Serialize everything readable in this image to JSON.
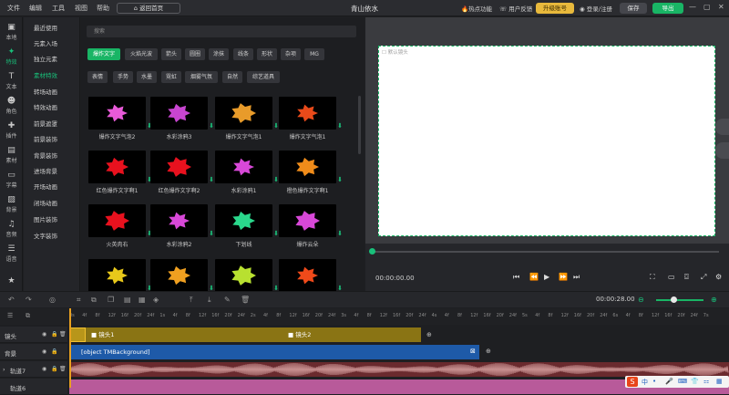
{
  "menu": [
    "文件",
    "编辑",
    "工具",
    "视图",
    "帮助"
  ],
  "home_button": "返回首页",
  "app_title": "青山依水",
  "header_right": {
    "hot": "热点功能",
    "feedback": "用户反馈",
    "upgrade": "升级账号",
    "login": "登录/注册",
    "save": "保存",
    "export": "导出"
  },
  "rail": [
    "本地",
    "特效",
    "文本",
    "角色",
    "插件",
    "素材",
    "字幕",
    "背景",
    "音频",
    "语音"
  ],
  "categories": [
    "最近使用",
    "元素入场",
    "独立元素",
    "素材特效",
    "转场动画",
    "特效动画",
    "前景遮罩",
    "前景装饰",
    "背景装饰",
    "进场背景",
    "开场动画",
    "闭场动画",
    "图片装饰",
    "文字装饰"
  ],
  "search_placeholder": "搜索",
  "chips_row1": [
    "爆炸文字",
    "火焰光波",
    "箭头",
    "圆圈",
    "涂抹",
    "线条",
    "形状",
    "杂项",
    "MG"
  ],
  "chips_row2": [
    "表情",
    "手势",
    "水墨",
    "霓虹",
    "烟雾气氛",
    "自然",
    "综艺道具"
  ],
  "effects": [
    {
      "label": "爆炸文字气泡2",
      "color": "#e85ad8"
    },
    {
      "label": "水彩涂鸦3",
      "color": "#c845d0"
    },
    {
      "label": "爆炸文字气泡1",
      "color": "#e89b2a"
    },
    {
      "label": "爆炸文字气泡1",
      "color": "#e84a1a"
    },
    {
      "label": "红色爆炸文字啊1",
      "color": "#e8111e"
    },
    {
      "label": "红色爆炸文字啊2",
      "color": "#e8111e"
    },
    {
      "label": "水彩涂鸦1",
      "color": "#d848d8"
    },
    {
      "label": "橙色爆炸文字啊1",
      "color": "#f08c1a"
    },
    {
      "label": "火英肉右",
      "color": "#e8111e"
    },
    {
      "label": "水彩涂鸦2",
      "color": "#d848d8"
    },
    {
      "label": "下划线",
      "color": "#2ad88c"
    },
    {
      "label": "爆炸云朵",
      "color": "#d848d8"
    },
    {
      "label": "",
      "color": "#e8c81a"
    },
    {
      "label": "",
      "color": "#f0a020"
    },
    {
      "label": "",
      "color": "#b8e030"
    },
    {
      "label": "",
      "color": "#f04a1a"
    }
  ],
  "canvas_label": "默认镜头",
  "timecode": "00:00:00.00",
  "duration": "00:00:28.00",
  "ruler_ticks": [
    "0s",
    "4f",
    "8f",
    "12f",
    "16f",
    "20f",
    "24f",
    "1s",
    "4f",
    "8f",
    "12f",
    "16f",
    "20f",
    "24f",
    "2s",
    "4f",
    "8f",
    "12f",
    "16f",
    "20f",
    "24f",
    "3s",
    "4f",
    "8f",
    "12f",
    "16f",
    "20f",
    "24f",
    "4s",
    "4f",
    "8f",
    "12f",
    "16f",
    "20f",
    "24f",
    "5s",
    "4f",
    "8f",
    "12f",
    "16f",
    "20f",
    "24f",
    "6s",
    "4f",
    "8f",
    "12f",
    "16f",
    "20f",
    "24f",
    "7s"
  ],
  "tracks": [
    {
      "name": "镜头"
    },
    {
      "name": "背景"
    },
    {
      "name": "轨道7"
    },
    {
      "name": "轨道6"
    }
  ],
  "clips": {
    "shot1": "镜头1",
    "shot2": "镜头2",
    "background": "[object TMBackground]"
  },
  "ime": [
    "中",
    "•",
    "🎤",
    "⌨",
    "👕",
    "⚏"
  ]
}
